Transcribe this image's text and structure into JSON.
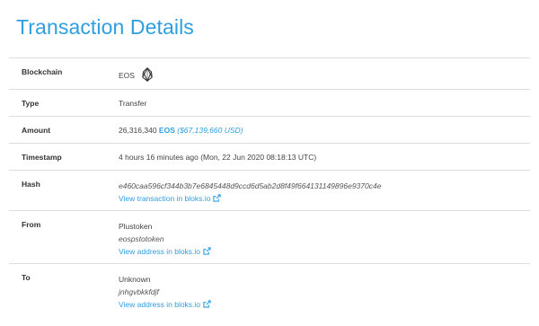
{
  "page": {
    "title": "Transaction Details"
  },
  "rows": {
    "blockchain": {
      "label": "Blockchain",
      "value": "EOS",
      "icon": "eos-logo-icon"
    },
    "type": {
      "label": "Type",
      "value": "Transfer"
    },
    "amount": {
      "label": "Amount",
      "quantity": "26,316,340",
      "currency": "EOS",
      "usd": "($67,139,660 USD)"
    },
    "timestamp": {
      "label": "Timestamp",
      "value": "4 hours 16 minutes ago (Mon, 22 Jun 2020 08:18:13 UTC)"
    },
    "hash": {
      "label": "Hash",
      "value": "e460caa596cf344b3b7e6845448d9ccd6d5ab2d8f49f664131149896e9370c4e",
      "link": "View transaction in bloks.io"
    },
    "from": {
      "label": "From",
      "name": "Plustoken",
      "account": "eospstotoken",
      "link": "View address in bloks.io"
    },
    "to": {
      "label": "To",
      "name": "Unknown",
      "account": "jnhgvbkkfdjf",
      "link": "View address in bloks.io"
    }
  },
  "colors": {
    "accent": "#2f9ee0",
    "border": "#dddddd",
    "text": "#333333"
  }
}
